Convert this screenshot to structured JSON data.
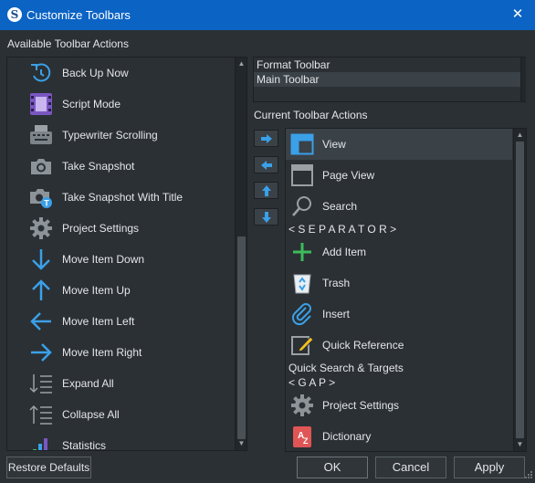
{
  "window": {
    "title": "Customize Toolbars",
    "app_icon_letter": "S",
    "close_glyph": "✕"
  },
  "available": {
    "heading": "Available Toolbar Actions",
    "items": [
      {
        "label": "Back Up Now",
        "icon": "backup-icon"
      },
      {
        "label": "Script Mode",
        "icon": "script-mode-icon"
      },
      {
        "label": "Typewriter Scrolling",
        "icon": "typewriter-icon"
      },
      {
        "label": "Take Snapshot",
        "icon": "camera-icon"
      },
      {
        "label": "Take Snapshot With Title",
        "icon": "camera-title-icon"
      },
      {
        "label": "Project Settings",
        "icon": "gear-icon"
      },
      {
        "label": "Move Item Down",
        "icon": "arrow-down-icon"
      },
      {
        "label": "Move Item Up",
        "icon": "arrow-up-icon"
      },
      {
        "label": "Move Item Left",
        "icon": "arrow-left-icon"
      },
      {
        "label": "Move Item Right",
        "icon": "arrow-right-icon"
      },
      {
        "label": "Expand All",
        "icon": "expand-all-icon"
      },
      {
        "label": "Collapse All",
        "icon": "collapse-all-icon"
      },
      {
        "label": "Statistics",
        "icon": "statistics-icon"
      }
    ]
  },
  "toolbars": {
    "items": [
      "Format Toolbar",
      "Main Toolbar"
    ],
    "selected": "Main Toolbar"
  },
  "current": {
    "heading": "Current Toolbar Actions",
    "items": [
      {
        "kind": "action",
        "label": "View",
        "icon": "view-icon",
        "selected": true
      },
      {
        "kind": "action",
        "label": "Page View",
        "icon": "page-view-icon"
      },
      {
        "kind": "action",
        "label": "Search",
        "icon": "search-icon"
      },
      {
        "kind": "text",
        "label": "< S E P A R A T O R >"
      },
      {
        "kind": "action",
        "label": "Add Item",
        "icon": "plus-icon"
      },
      {
        "kind": "action",
        "label": "Trash",
        "icon": "trash-icon"
      },
      {
        "kind": "action",
        "label": "Insert",
        "icon": "paperclip-icon"
      },
      {
        "kind": "action",
        "label": "Quick Reference",
        "icon": "quick-reference-icon"
      },
      {
        "kind": "text",
        "label": "Quick Search & Targets"
      },
      {
        "kind": "text",
        "label": "< G A P >"
      },
      {
        "kind": "action",
        "label": "Project Settings",
        "icon": "gear-icon"
      },
      {
        "kind": "action",
        "label": "Dictionary",
        "icon": "dictionary-icon"
      }
    ]
  },
  "buttons": {
    "restore": "Restore Defaults",
    "ok": "OK",
    "cancel": "Cancel",
    "apply": "Apply"
  },
  "colors": {
    "titlebar": "#0b63c4",
    "accent_blue": "#3aa0e8",
    "green": "#3dbb5c",
    "background": "#2b3034"
  }
}
